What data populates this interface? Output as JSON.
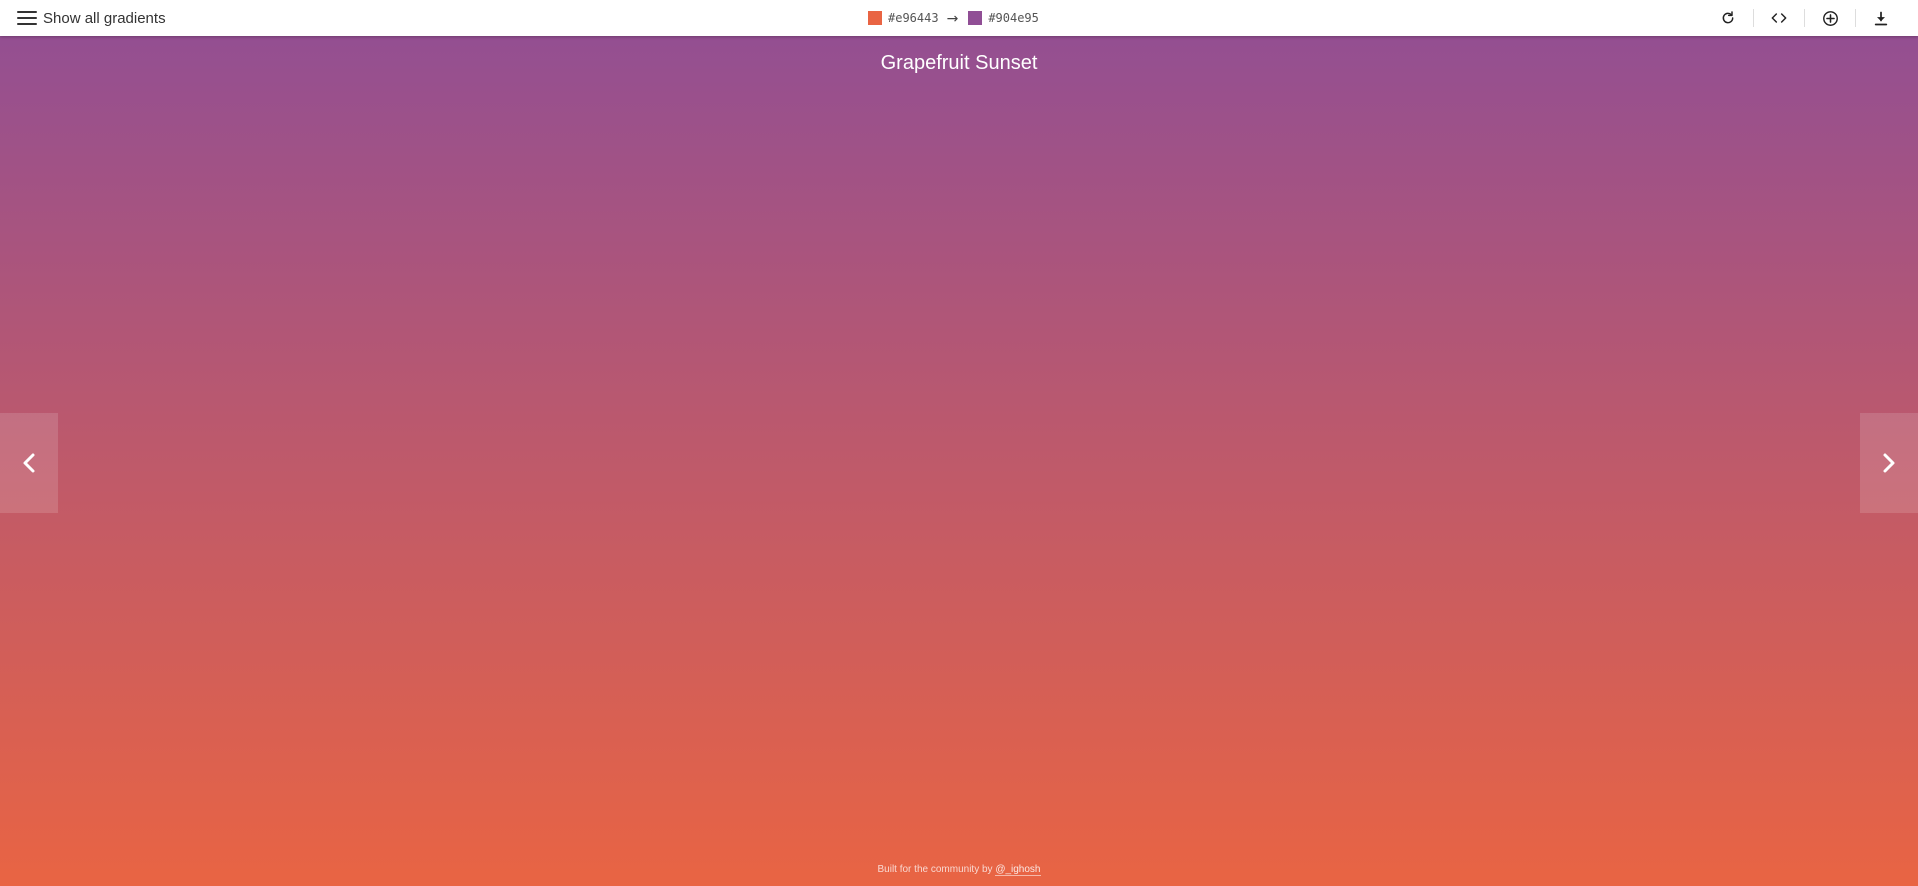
{
  "gradient": {
    "name": "Grapefruit Sunset",
    "color_start": "#e96443",
    "color_end": "#904e95"
  },
  "header": {
    "menu_label": "Show all gradients",
    "color_from": "#e96443",
    "arrow": "→",
    "color_to": "#904e95",
    "actions": [
      {
        "icon": "rotate-icon"
      },
      {
        "icon": "code-icon"
      },
      {
        "icon": "add-circle-icon"
      },
      {
        "icon": "download-icon"
      }
    ]
  },
  "navigation": {
    "prev_icon": "chevron-left-icon",
    "next_icon": "chevron-right-icon"
  },
  "footer": {
    "text": "Built for the community by",
    "link_text": "@_ighosh"
  }
}
